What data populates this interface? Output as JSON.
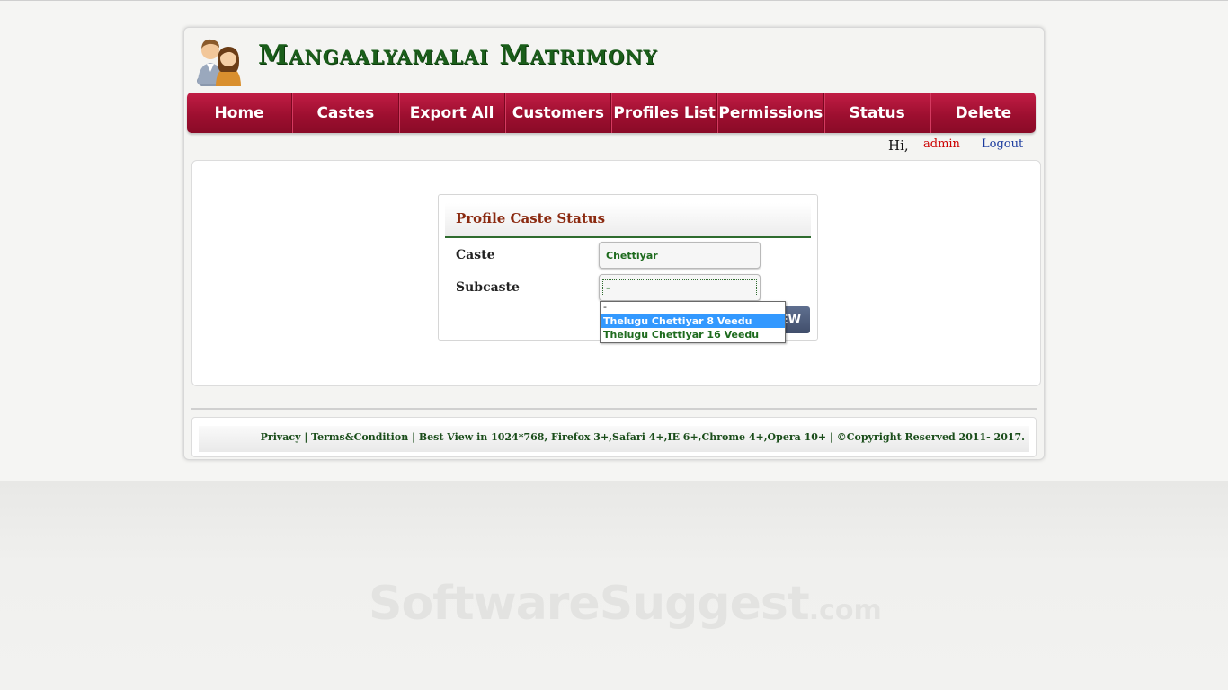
{
  "header": {
    "site_title": "Mangaalyamalai Matrimony",
    "logo_icon": "couple-people-icon"
  },
  "nav": {
    "items": [
      {
        "label": "Home"
      },
      {
        "label": "Castes"
      },
      {
        "label": "Export All"
      },
      {
        "label": "Customers"
      },
      {
        "label": "Profiles List"
      },
      {
        "label": "Permissions"
      },
      {
        "label": "Status"
      },
      {
        "label": "Delete"
      }
    ]
  },
  "user_bar": {
    "greeting": "Hi,",
    "username": "admin",
    "logout_label": "Logout"
  },
  "form": {
    "title": "Profile Caste Status",
    "caste_label": "Caste",
    "caste_value": "Chettiyar",
    "subcaste_label": "Subcaste",
    "subcaste_value": "-",
    "subcaste_options": [
      {
        "label": "-"
      },
      {
        "label": "Thelugu Chettiyar 8 Veedu",
        "highlighted": true
      },
      {
        "label": "Thelugu Chettiyar 16 Veedu"
      }
    ],
    "view_button_visible_text": "EW"
  },
  "footer": {
    "text": "Privacy | Terms&Condition | Best View in 1024*768, Firefox 3+,Safari 4+,IE 6+,Chrome 4+,Opera 10+ | ©Copyright Reserved 2011- 2017."
  },
  "watermark": {
    "main": "SoftwareSuggest",
    "suffix": ".com"
  },
  "colors": {
    "nav_red": "#a3112f",
    "title_green": "#1a5e1a",
    "form_title_brown": "#8b2a10",
    "username_red": "#cc0000",
    "logout_blue": "#1a3a9e",
    "highlight_blue": "#3399ff"
  }
}
